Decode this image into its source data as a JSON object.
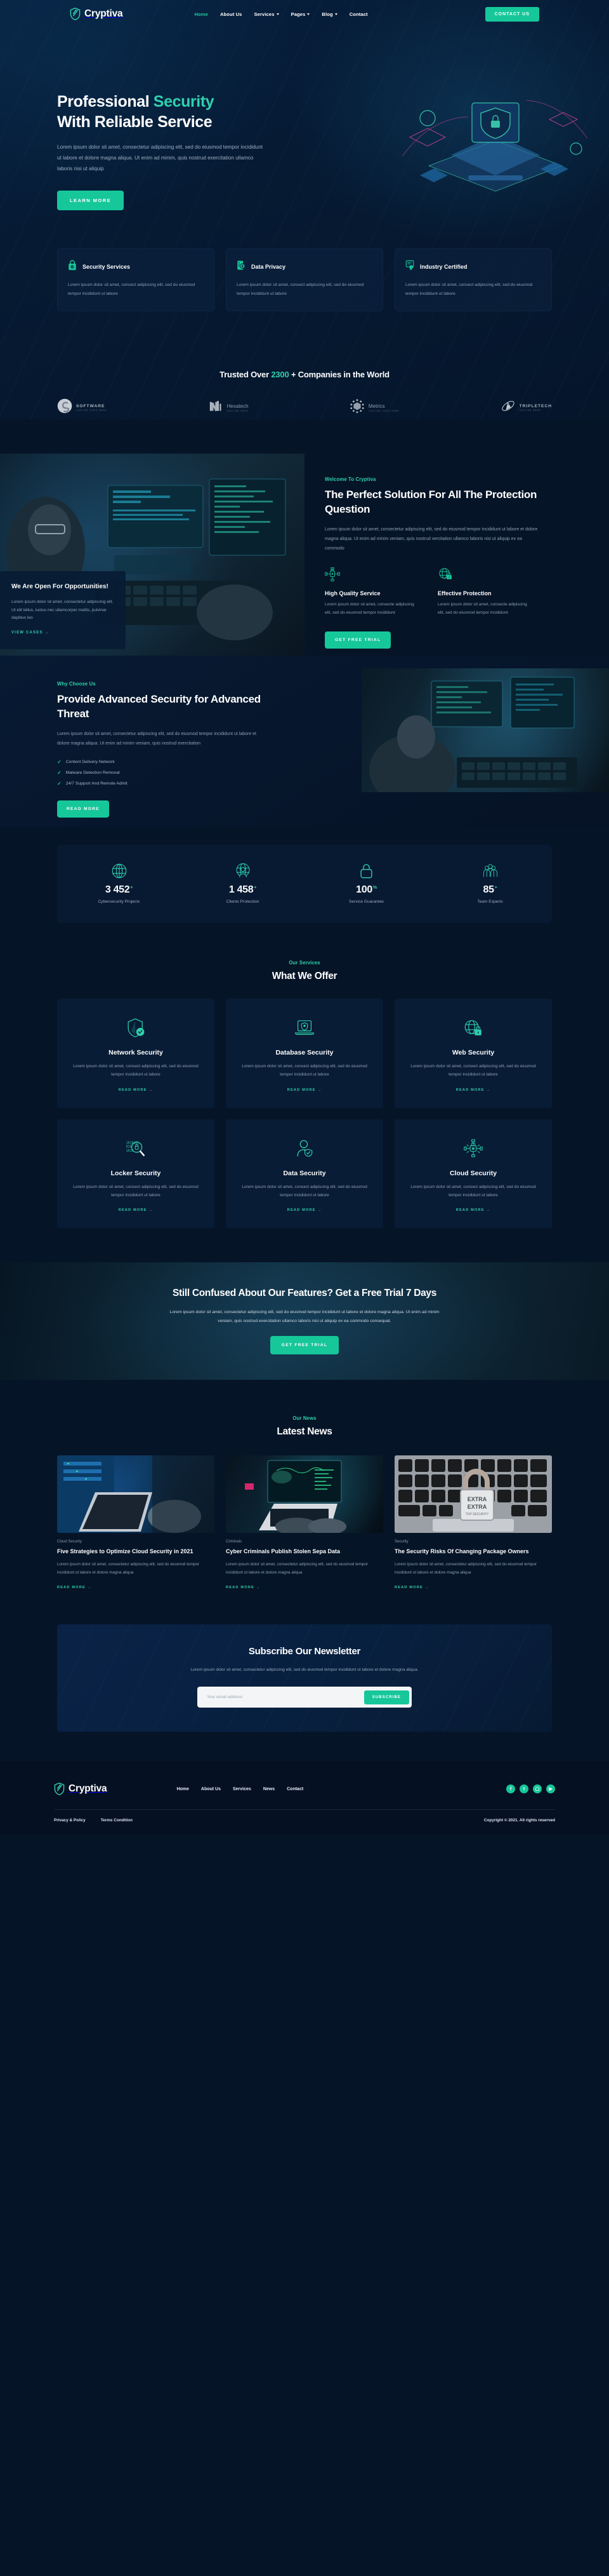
{
  "brand": {
    "name": "Cryptiva",
    "icon": "shield-icon"
  },
  "header": {
    "nav": [
      {
        "label": "Home",
        "active": true,
        "caret": false
      },
      {
        "label": "About Us",
        "active": false,
        "caret": false
      },
      {
        "label": "Services",
        "active": false,
        "caret": true
      },
      {
        "label": "Pages",
        "active": false,
        "caret": true
      },
      {
        "label": "Blog",
        "active": false,
        "caret": true
      },
      {
        "label": "Contact",
        "active": false,
        "caret": false
      }
    ],
    "cta_label": "CONTACT US"
  },
  "hero": {
    "title_1": "Professional ",
    "title_accent": "Security",
    "title_2": "With Reliable Service",
    "subtitle": "Lorem ipsum dolor sit amet, consectetur adipiscing elit, sed do eiusmod tempor incididunt ut labore et dolore magna aliqua. Ut enim ad minim, quis nostrud exercitation ullamco laboris nisi ut aliquip",
    "button": "LEARN MORE"
  },
  "features": [
    {
      "icon": "lock-check-icon",
      "title": "Security Services",
      "text": "Lorem ipsum dolor sit amet, consect adipiscing elit, sed do eiusmod tempor incididunt ut labore"
    },
    {
      "icon": "file-lock-icon",
      "title": "Data Privacy",
      "text": "Lorem ipsum dolor sit amet, consect adipiscing elit, sed do eiusmod tempor incididunt ut labore"
    },
    {
      "icon": "certificate-icon",
      "title": "Industry Certified",
      "text": "Lorem ipsum dolor sit amet, consect adipiscing elit, sed do eiusmod tempor incididunt ut labore"
    }
  ],
  "trusted": {
    "prefix": "Trusted Over ",
    "count": "2300",
    "suffix": " + Companies in the World",
    "logos": [
      {
        "name": "SOFTWARE",
        "tagline": "TAGLINE GOES HERE",
        "mark": "s-swirl-logo"
      },
      {
        "name": "Hexatech",
        "tagline": "TAGLINE HERE",
        "mark": "hexatech-logo"
      },
      {
        "name": "Metrics",
        "tagline": "TAGLINE GOES HERE",
        "mark": "metrics-dots-logo"
      },
      {
        "name": "TRIPLETECH",
        "tagline": "TAGLINE HERE",
        "mark": "tripletech-logo"
      }
    ]
  },
  "about": {
    "eyebrow": "Welcome To Cryptiva",
    "title": "The Perfect Solution For All The Protection Question",
    "body": "Lorem ipsum dolor sit amet, consectetur adipiscing elit, sed do eiusmod tempor incididunt ut labore et dolore magna aliqua. Ut enim ad minim veniam, quis nostrud xercitation ullamco laboris nisi ut aliquip ex ea commodo",
    "minis": [
      {
        "icon": "network-lock-icon",
        "title": "High Quality Service",
        "text": "Lorem ipsum dolor sit amet, consecte adipiscing elit, sed do eiusmod tempor incididunt"
      },
      {
        "icon": "globe-lock-icon",
        "title": "Effective Protection",
        "text": "Lorem ipsum dolor sit amet, consecte adipiscing elit, sed do eiusmod tempor incididunt"
      }
    ],
    "button": "GET FREE TRIAL",
    "opportunity": {
      "title": "We Are Open For Opportunities!",
      "text": "Lorem ipsum dolor sit amet, consectetur adipiscing elit. Ut elit tellus, luctus nec ullamcorper mattis, pulvinar dapibus leo",
      "link": "VIEW CASES"
    }
  },
  "why": {
    "eyebrow": "Why Choose Us",
    "title": "Provide Advanced Security for Advanced Threat",
    "body": "Lorem ipsum dolor sit amet, consectetur adipiscing elit, sed do eiusmod tempor incididunt ut labore et dolore magna aliqua. Ut enim ad minim veniam, quis nostrud exercitation",
    "checks": [
      "Content Delivery Network",
      "Malware Detection Removal",
      "24/7 Support And Remote Admit"
    ],
    "button": "READ MORE"
  },
  "counters": [
    {
      "icon": "globe-icon",
      "value": "3 452",
      "suffix": "+",
      "label": "Cybersecurity Projects"
    },
    {
      "icon": "globe-person-icon",
      "value": "1 458",
      "suffix": "+",
      "label": "Clients Protection"
    },
    {
      "icon": "padlock-icon",
      "value": "100",
      "suffix": "%",
      "label": "Service Guarantee"
    },
    {
      "icon": "team-icon",
      "value": "85",
      "suffix": "+",
      "label": "Team Experts"
    }
  ],
  "services": {
    "eyebrow": "Our Services",
    "title": "What We Offer",
    "read_more": "READ MORE",
    "items": [
      {
        "icon": "shield-check-icon",
        "title": "Network Security",
        "text": "Lorem ipsum dolor sit amet, consect adipiscing elit, sed do eiusmod tempor incididunt ut labore"
      },
      {
        "icon": "laptop-shield-icon",
        "title": "Database Security",
        "text": "Lorem ipsum dolor sit amet, consect adipiscing elit, sed do eiusmod tempor incididunt ut labore"
      },
      {
        "icon": "globe-lock-icon",
        "title": "Web Security",
        "text": "Lorem ipsum dolor sit amet, consect adipiscing elit, sed do eiusmod tempor incididunt ut labore"
      },
      {
        "icon": "binary-search-lock-icon",
        "title": "Locker Security",
        "text": "Lorem ipsum dolor sit amet, consect adipiscing elit, sed do eiusmod tempor incididunt ut labore"
      },
      {
        "icon": "user-shield-icon",
        "title": "Data Security",
        "text": "Lorem ipsum dolor sit amet, consect adipiscing elit, sed do eiusmod tempor incididunt ut labore"
      },
      {
        "icon": "cloud-lock-network-icon",
        "title": "Cloud Security",
        "text": "Lorem ipsum dolor sit amet, consect adipiscing elit, sed do eiusmod tempor incididunt ut labore"
      }
    ]
  },
  "cta": {
    "title": "Still Confused About Our Features? Get a Free Trial 7 Days",
    "text": "Lorem ipsum dolor sit amet, consectetur adipiscing elit, sed do eiusmod tempor incididunt ut labore et dolore magna aliqua. Ut enim ad minim veniam, quis nostrud exercitation ullamco laboris nisi ut aliquip ex ea commodo consequat.",
    "button": "GET FREE TRIAL"
  },
  "news": {
    "eyebrow": "Our News",
    "title": "Latest News",
    "read_more": "READ MORE",
    "items": [
      {
        "category": "Cloud Security",
        "title": "Five Strategies to Optimize Cloud Security in 2021",
        "text": "Lorem ipsum dolor sit amet, consectetur adipiscing elit, sed do eiusmod tempor incididunt ut labore et dolore magna aliqua"
      },
      {
        "category": "Criminals",
        "title": "Cyber Criminals Publish Stolen Sepa Data",
        "text": "Lorem ipsum dolor sit amet, consectetur adipiscing elit, sed do eiusmod tempor incididunt ut labore et dolore magna aliqua"
      },
      {
        "category": "Security",
        "title": "The Security Risks Of Changing Package Owners",
        "text": "Lorem ipsum dolor sit amet, consectetur adipiscing elit, sed do eiusmod tempor incididunt ut labore et dolore magna aliqua"
      }
    ]
  },
  "newsletter": {
    "title": "Subscribe Our Newsletter",
    "text": "Lorem ipsum dolor sit amet, consectetur adipiscing elit, sed do eiusmod tempor incididunt ut labore et dolore magna aliqua.",
    "placeholder": "Your email address",
    "value": "",
    "button": "SUBSCRIBE"
  },
  "footer": {
    "nav": [
      "Home",
      "About Us",
      "Services",
      "News",
      "Contact"
    ],
    "socials": [
      {
        "name": "facebook-icon",
        "glyph": "f"
      },
      {
        "name": "twitter-icon",
        "glyph": "t"
      },
      {
        "name": "instagram-icon",
        "glyph": "▢"
      },
      {
        "name": "youtube-icon",
        "glyph": "▶"
      }
    ],
    "privacy": "Privacy & Policy",
    "terms": "Terms Condition",
    "copyright": "Copyright © 2021. All rights reserved"
  },
  "colors": {
    "accent": "#16c79a",
    "accent_light": "#2fd0ae",
    "bg": "#061427",
    "card": "#0b203c"
  }
}
